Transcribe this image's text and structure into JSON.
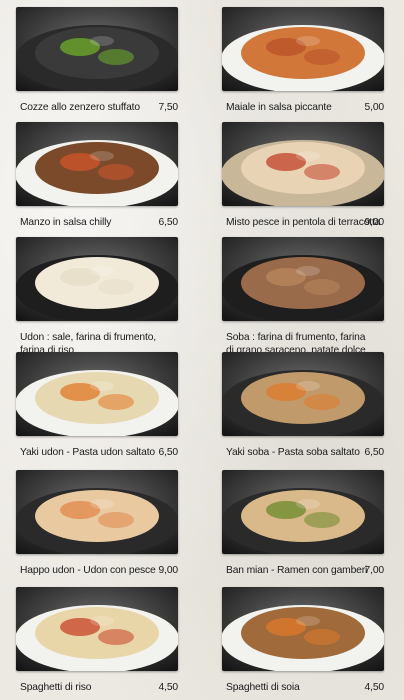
{
  "dishes": [
    {
      "name": "Cozze allo zenzero stuffato",
      "price": "7,50",
      "plate": "#2a2a2a",
      "food": "#3a3a3a",
      "accent": "#6fae2a"
    },
    {
      "name": "Maiale in salsa piccante",
      "price": "5,00",
      "plate": "#f2f2ee",
      "food": "#d2773a",
      "accent": "#b8502a"
    },
    {
      "name": "Manzo in salsa chilly",
      "price": "6,50",
      "plate": "#f2f2ee",
      "food": "#7a4a2a",
      "accent": "#d2552a"
    },
    {
      "name": "Misto pesce in pentola di terracotta",
      "price": "9,00",
      "plate": "#c9b79a",
      "food": "#e8d4b4",
      "accent": "#c2412a"
    },
    {
      "name": "Udon : sale, farina di frumento,",
      "name2": "farina di riso",
      "price": "",
      "plate": "#1e1e1e",
      "food": "#f1ead9",
      "accent": "#e6dcc6"
    },
    {
      "name": "Soba : farina di frumento, farina",
      "name2": "di grano saraceno, patate dolce",
      "price": "",
      "plate": "#1e1e1e",
      "food": "#9a6b4a",
      "accent": "#b8865e"
    },
    {
      "name": "Yaki udon - Pasta udon saltato",
      "price": "6,50",
      "plate": "#f2f2ee",
      "food": "#e6d8b0",
      "accent": "#e07a2a"
    },
    {
      "name": "Yaki soba - Pasta soba saltato",
      "price": "6,50",
      "plate": "#2a2a2a",
      "food": "#c09a6a",
      "accent": "#e07a2a"
    },
    {
      "name": "Happo udon - Udon con pesce",
      "price": "9,00",
      "plate": "#2a2a2a",
      "food": "#e8c9a0",
      "accent": "#e0874a"
    },
    {
      "name": "Ban mian - Ramen con gamberi",
      "price": "7,00",
      "plate": "#2a2a2a",
      "food": "#d9b98a",
      "accent": "#6a8a2a"
    },
    {
      "name": "Spaghetti di riso",
      "price": "4,50",
      "plate": "#f2f2ee",
      "food": "#e8d6a8",
      "accent": "#c8412a"
    },
    {
      "name": "Spaghetti di soia",
      "price": "4,50",
      "plate": "#f2f2ee",
      "food": "#a06a3a",
      "accent": "#e07a2a"
    }
  ]
}
